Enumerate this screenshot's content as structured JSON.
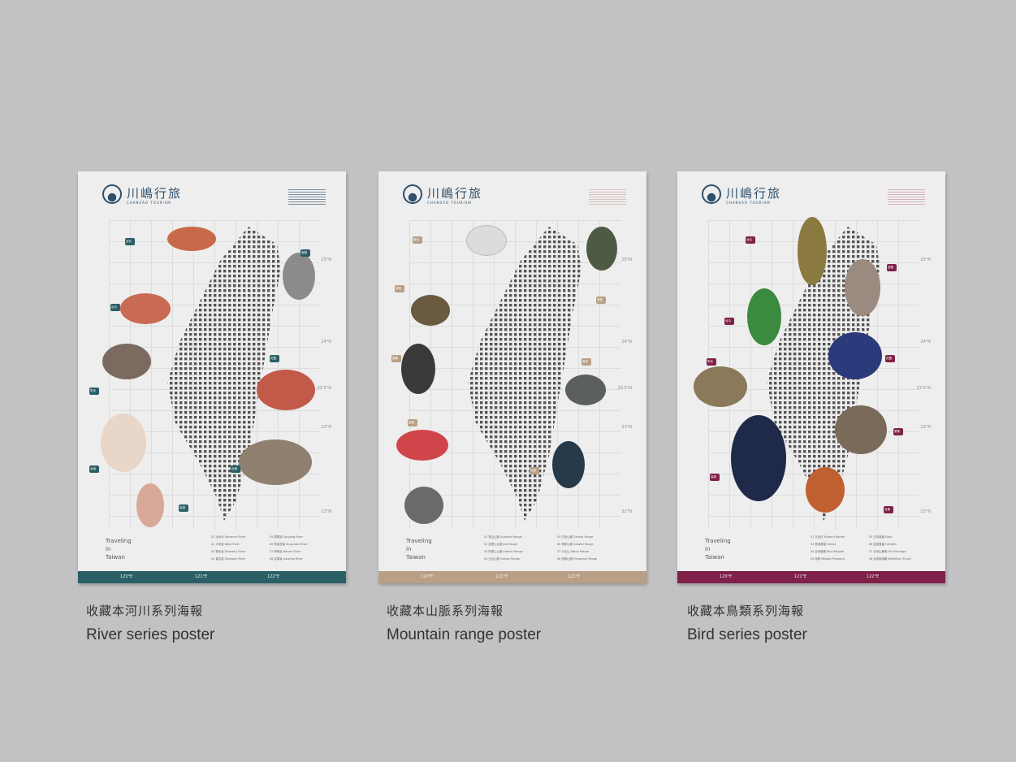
{
  "posters": [
    {
      "logo_title": "川嶋行旅",
      "logo_sub": "CHANSAO TOURISM",
      "accent": "#2b5f66",
      "wave_color": "#2f4f6a",
      "caption_zh": "收藏本河川系列海報",
      "caption_en": "River series poster",
      "pins": [
        "台北",
        "宜蘭",
        "台中",
        "花蓮",
        "彰化",
        "台東",
        "台南",
        "高雄"
      ],
      "legend": [
        "01 淡水河 Danshuei River",
        "02 大甲溪 Dajia River",
        "03 濁水溪 Zhuoshui River",
        "04 曾文溪 Zengwen River",
        "05 蘭陽溪 Lanyang River",
        "06 秀姑巒溪 Xiuguluan River",
        "07 卑南溪 Beinan River",
        "08 高屏溪 Gaoping River"
      ]
    },
    {
      "logo_title": "川嶋行旅",
      "logo_sub": "CHANSAO TOURISM",
      "accent": "#b89f86",
      "wave_color": "#c9a89a",
      "caption_zh": "收藏本山脈系列海報",
      "caption_en": "Mountain range poster",
      "pins": [
        "新北",
        "苗栗",
        "宜蘭",
        "嘉義",
        "南投",
        "高雄",
        "台東"
      ],
      "legend": [
        "01 雪山山脈 Xueshan Range",
        "02 加里山山脈 Jiali Range",
        "03 阿里山山脈 Alishan Range",
        "04 玉山山脈 Yushan Range",
        "05 中央山脈 Central Range",
        "06 海岸山脈 Coastal Range",
        "07 大屯山 Datun Range",
        "08 恆春山脈 Hengchun Range"
      ]
    },
    {
      "logo_title": "川嶋行旅",
      "logo_sub": "CHANSAO TOURISM",
      "accent": "#7f2148",
      "wave_color": "#c98a9a",
      "caption_zh": "收藏本鳥類系列海報",
      "caption_en": "Bird series poster",
      "pins": [
        "台北",
        "宜蘭",
        "台中",
        "花蓮",
        "彰化",
        "屏東",
        "高雄",
        "台東"
      ],
      "legend": [
        "01 五色鳥 Muller's Barbet",
        "02 冠羽畫眉 Yuhina",
        "03 台灣藍鵲 Blue Magpie",
        "04 帝雉 Mikado Pheasant",
        "05 白耳畫眉 Sibia",
        "06 紋翼畫眉 Fulvetta",
        "07 台灣山鷓鴣 Hill Partridge",
        "08 台灣紫嘯鶇 Whistling Thrush"
      ]
    }
  ],
  "coords": [
    "120°E",
    "121°E",
    "122°E"
  ],
  "latitudes": [
    "25°N",
    "24°N",
    "23.5°N",
    "23°N",
    "22°N"
  ],
  "traveling": [
    "Traveling",
    "in",
    "Taiwan"
  ]
}
